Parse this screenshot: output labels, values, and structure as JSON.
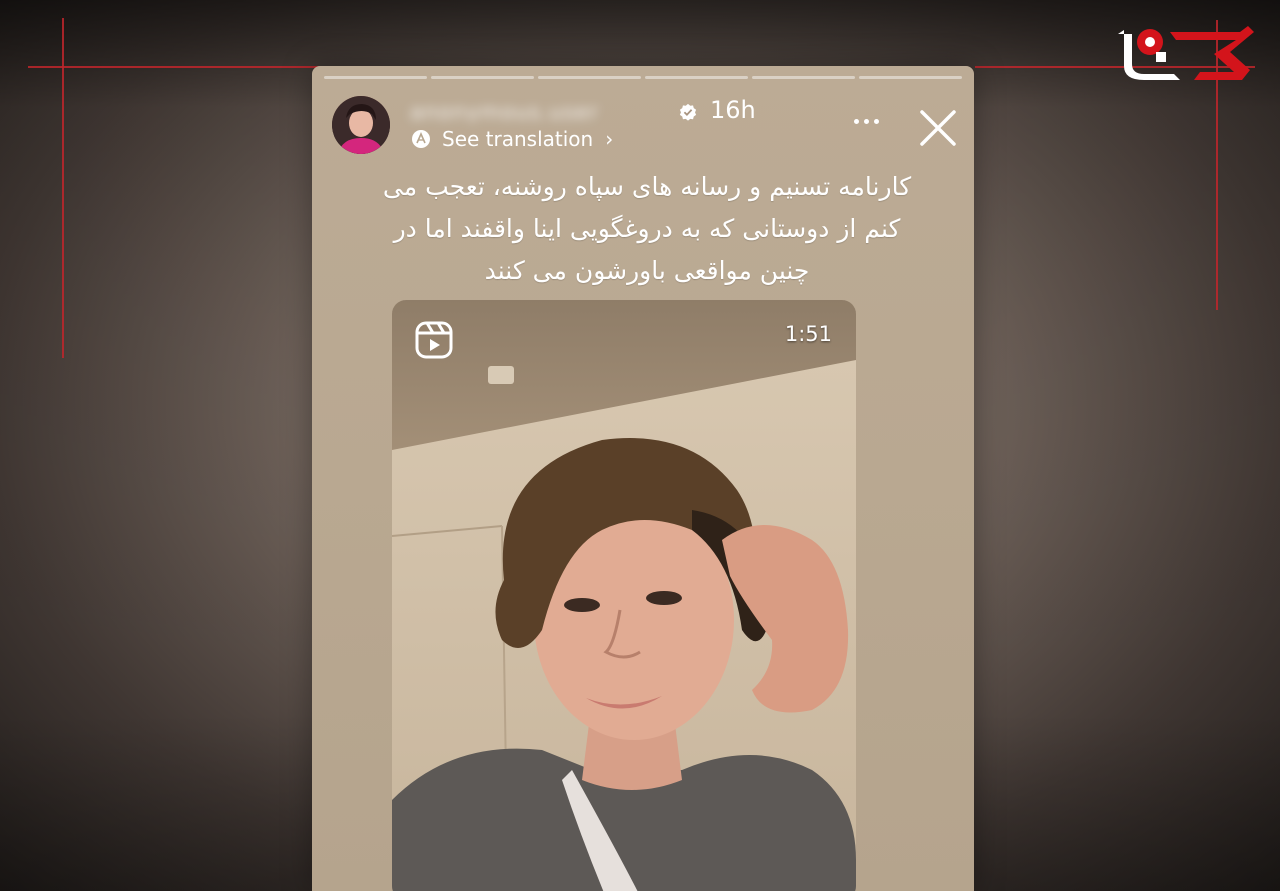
{
  "story": {
    "username": "anonymous.user",
    "verified": true,
    "time": "16h",
    "translation_label": "See translation",
    "caption_lines": [
      "کارنامه تسنیم و رسانه های سپاه روشنه، تعجب می",
      "کنم از دوستانی که به دروغگویی اینا واقفند اما در",
      "چنین مواقعی باورشون می کنند"
    ],
    "reel": {
      "duration": "1:51"
    },
    "progress_segments": 6
  },
  "icons": {
    "logo": "rokna-logo",
    "verified": "verified-badge-icon",
    "translate": "translate-icon",
    "more": "more-icon",
    "close": "close-icon",
    "reel": "reels-icon"
  },
  "colors": {
    "background": "#6f625a",
    "story_bg": "#bcab95",
    "accent_red": "#c0262c"
  }
}
